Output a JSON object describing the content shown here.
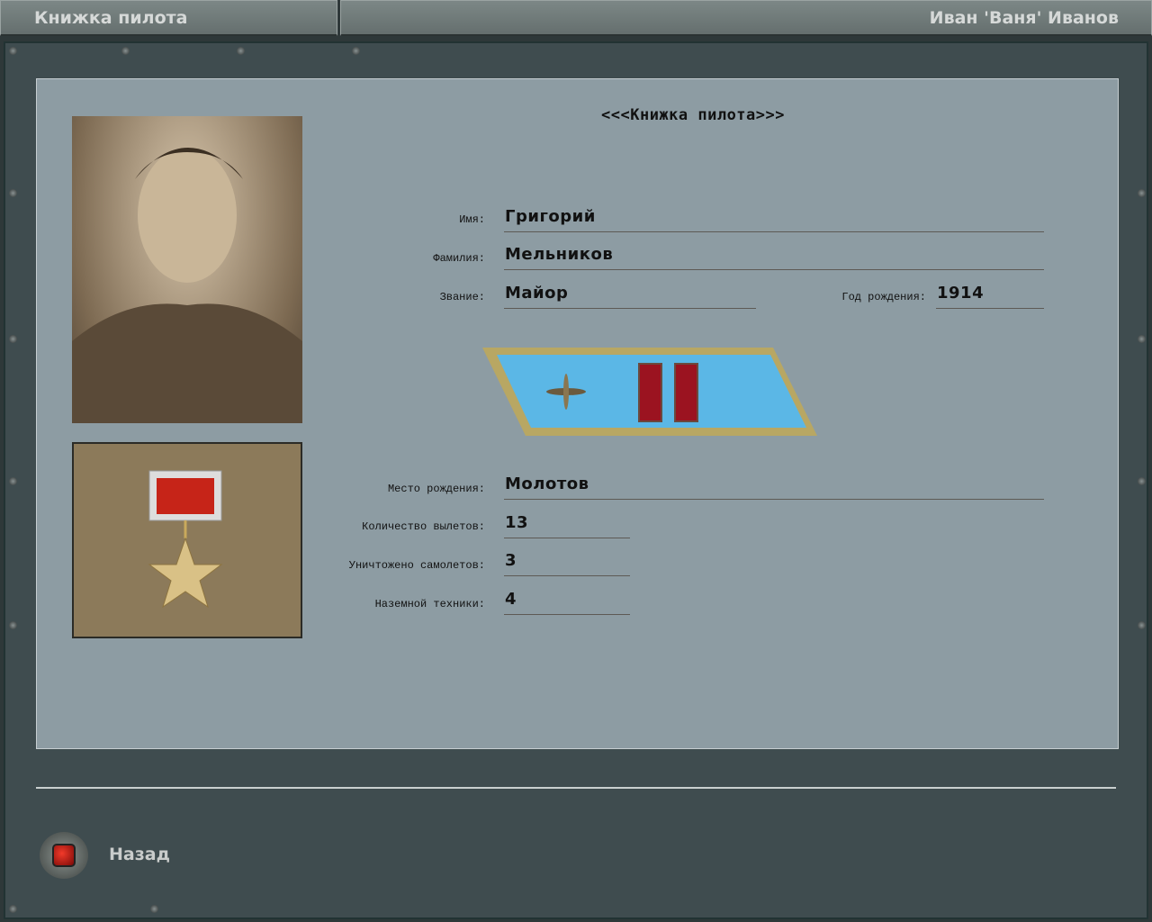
{
  "header": {
    "left_title": "Книжка пилота",
    "right_title": "Иван 'Ваня' Иванов"
  },
  "page_title": "<<<Книжка пилота>>>",
  "fields": {
    "first_name": {
      "label": "Имя:",
      "value": "Григорий"
    },
    "last_name": {
      "label": "Фамилия:",
      "value": "Мельников"
    },
    "rank": {
      "label": "Звание:",
      "value": "Майор"
    },
    "birth_year": {
      "label": "Год рождения:",
      "value": "1914"
    },
    "birthplace": {
      "label": "Место рождения:",
      "value": "Молотов"
    },
    "sorties": {
      "label": "Количество вылетов:",
      "value": "13"
    },
    "aircraft_destroyed": {
      "label": "Уничтожено самолетов:",
      "value": "3"
    },
    "ground_vehicles": {
      "label": "Наземной техники:",
      "value": "4"
    }
  },
  "back_button": {
    "label": "Назад"
  }
}
